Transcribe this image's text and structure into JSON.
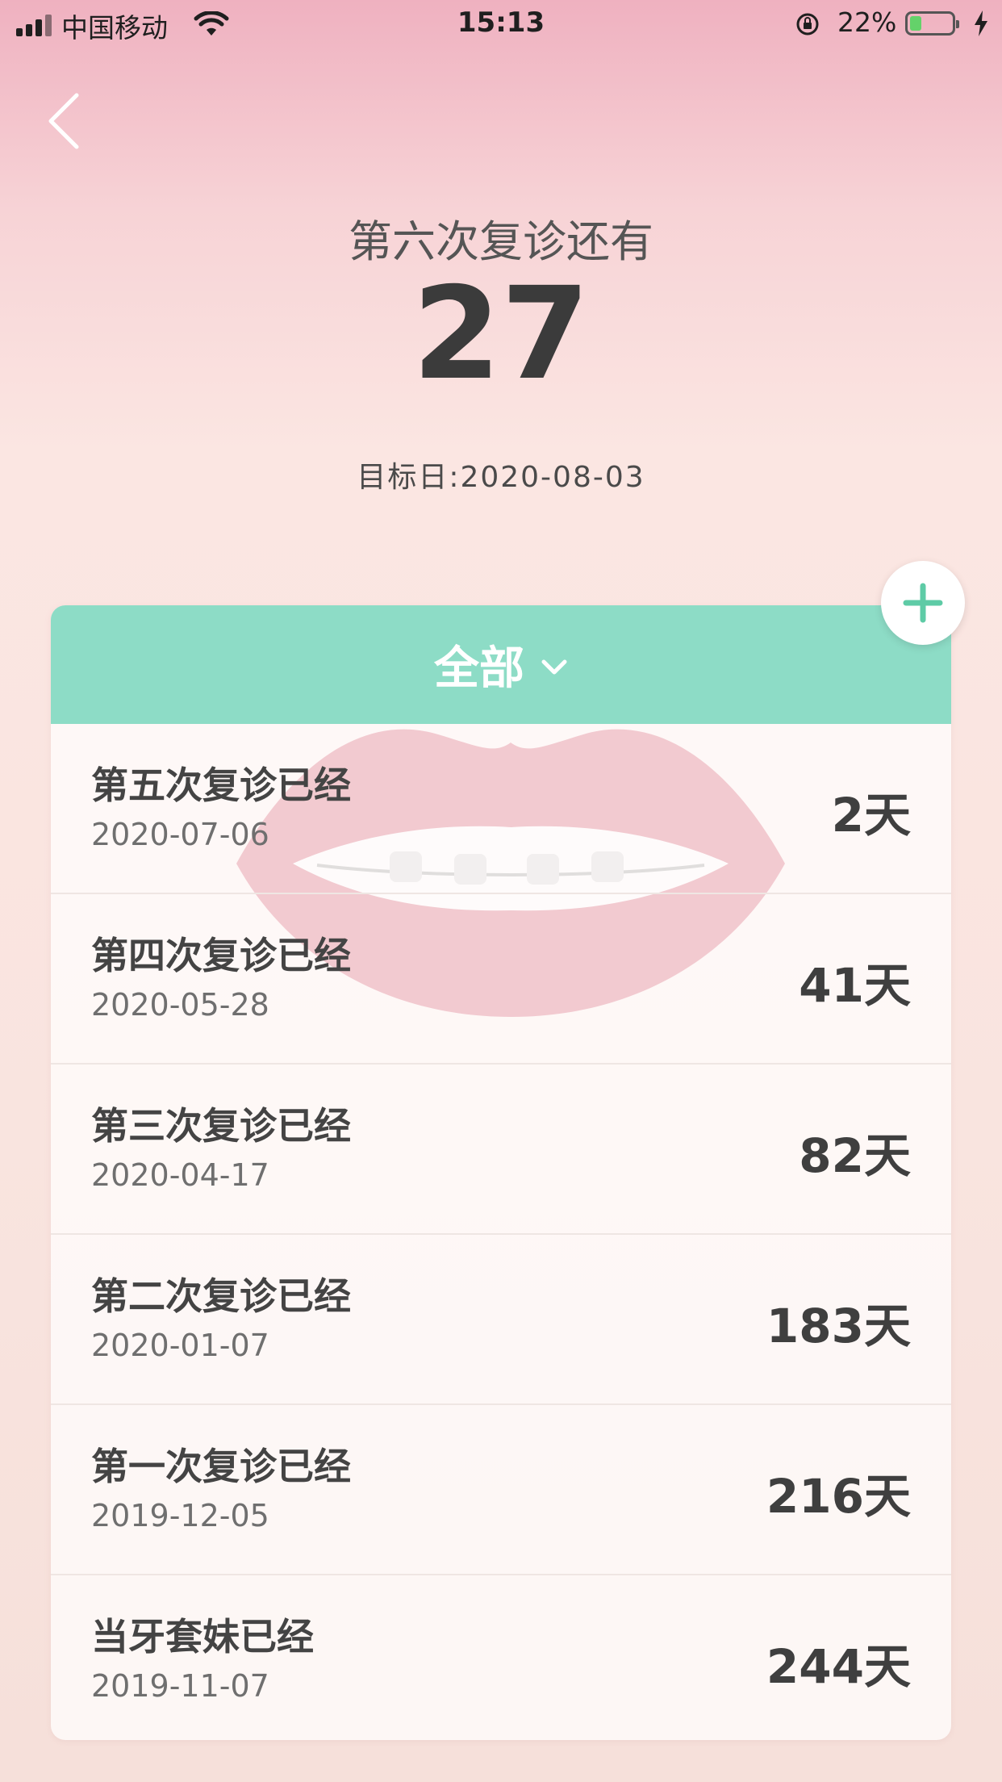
{
  "status_bar": {
    "carrier": "中国移动",
    "time": "15:13",
    "battery": "22%",
    "battery_level": 0.22
  },
  "header": {
    "subtitle": "第六次复诊还有",
    "countdown": "27",
    "target_date": "目标日:2020-08-03"
  },
  "filter": {
    "label": "全部"
  },
  "colors": {
    "accent": "#8ddcc6",
    "add_icon": "#5ecba6",
    "background_top": "#efb1c0"
  },
  "icons": {
    "back": "chevron-left-icon",
    "add": "plus-icon",
    "dropdown": "chevron-down-icon"
  },
  "records": [
    {
      "title": "第五次复诊已经",
      "date": "2020-07-06",
      "days": "2天"
    },
    {
      "title": "第四次复诊已经",
      "date": "2020-05-28",
      "days": "41天"
    },
    {
      "title": "第三次复诊已经",
      "date": "2020-04-17",
      "days": "82天"
    },
    {
      "title": "第二次复诊已经",
      "date": "2020-01-07",
      "days": "183天"
    },
    {
      "title": "第一次复诊已经",
      "date": "2019-12-05",
      "days": "216天"
    },
    {
      "title": "当牙套妹已经",
      "date": "2019-11-07",
      "days": "244天"
    }
  ]
}
